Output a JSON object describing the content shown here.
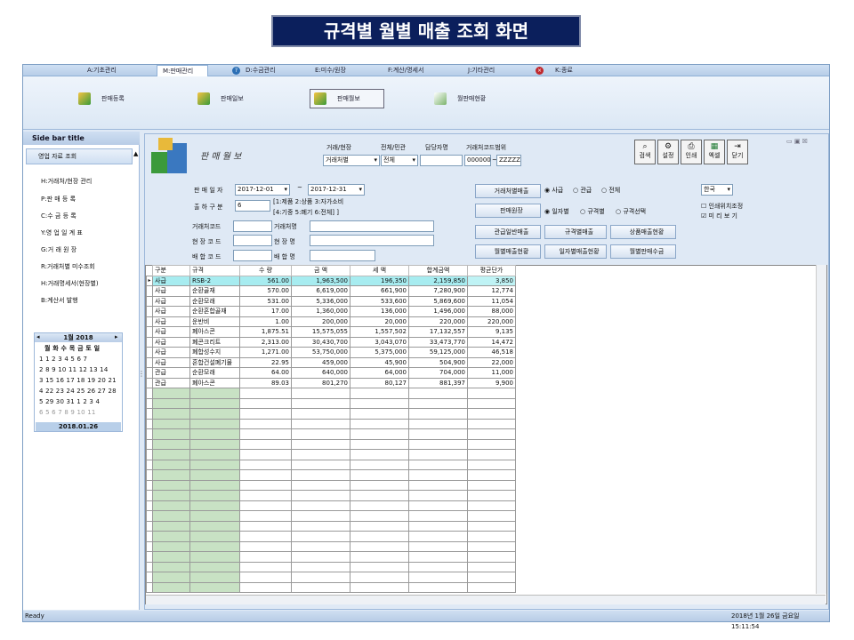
{
  "banner": "규격별 월별 매출 조회 화면",
  "menu": {
    "items": [
      {
        "label": "A:기초관리",
        "active": false
      },
      {
        "label": "M:판매관리",
        "active": true
      },
      {
        "label": "D:수금관리",
        "active": false
      },
      {
        "label": "E:미수/원장",
        "active": false
      },
      {
        "label": "F:계산/명세서",
        "active": false
      },
      {
        "label": "J:기타관리",
        "active": false
      },
      {
        "label": "K:종료",
        "active": false
      }
    ]
  },
  "ribbon": {
    "items": [
      "판매등록",
      "판매일보",
      "판매월보",
      "월판매현황"
    ]
  },
  "sidebar": {
    "title": "Side bar title",
    "section": "영업 자료 조회",
    "items": [
      "H:거래처/현장 관리",
      "P:판 매 등 록",
      "C:수 금 등 록",
      "Y:영 업 일 계 표",
      "G:거 래 원 장",
      "R:거래처별 미수조회",
      "H:거래명세서(현장별)",
      "B:계산서 발행"
    ]
  },
  "calendar": {
    "title": "1월 2018",
    "weekdays": "월 화 수 목 금 토 일",
    "rows": [
      "1  1  2  3  4  5  6  7",
      "2  8  9 10 11 12 13 14",
      "3 15 16 17 18 19 20 21",
      "4 22 23 24 25 26 27 28",
      "5 29 30 31  1  2  3  4",
      "6  5  6  7  8  9 10 11"
    ],
    "today": "2018.01.26"
  },
  "form": {
    "title": "판 매 월 보",
    "trade_site_label": "거래/현장",
    "trade_site_value": "거래처별",
    "all_label": "전체/민관",
    "all_value": "전체",
    "staff_label": "담당자명",
    "range_label": "거래처코드범위",
    "range_from": "000000",
    "range_sep": "~",
    "range_to": "ZZZZZ",
    "date_label": "판 매 일 자",
    "date_from": "2017-12-01",
    "date_tilde": "~",
    "date_to": "2017-12-31",
    "ship_label": "출 하 구 분",
    "ship_value": "6",
    "ship_note1": "[1:제품 2:상품 3:자가소비",
    "ship_note2": "[4:기중 5:폐기 6:전체] ]",
    "code_label": "거래처코드",
    "name_label": "거래처명",
    "site_code_label": "현 장 코 드",
    "site_name_label": "현 장 명",
    "mix_code_label": "배 합 코 드",
    "mix_name_label": "배 합 명"
  },
  "toolbar": {
    "search": "검색",
    "setting": "설정",
    "print": "인쇄",
    "excel": "엑셀",
    "close": "닫기"
  },
  "reports": {
    "r1": "거래처별매출",
    "r2": "판매원장",
    "r3": "관급일반매출",
    "r4": "규격별매출",
    "r5": "상품매출현황",
    "r6": "월별매출현황",
    "r7": "일자별매출현황",
    "r8": "월별판매수금"
  },
  "radios1": {
    "a": "사급",
    "b": "관급",
    "c": "전체"
  },
  "radios2": {
    "a": "일자별",
    "b": "규격별",
    "c": "규격선택"
  },
  "lang": "한국",
  "checks": {
    "a": "인쇄위치조정",
    "b": "미 리 보 기"
  },
  "table": {
    "headers": [
      "구분",
      "규격",
      "수 량",
      "금 액",
      "세 액",
      "합계금액",
      "평균단가"
    ],
    "rows": [
      [
        "사급",
        "RSB-2",
        "561.00",
        "1,963,500",
        "196,350",
        "2,159,850",
        "3,850"
      ],
      [
        "사급",
        "순환골재",
        "570.00",
        "6,619,000",
        "661,900",
        "7,280,900",
        "12,774"
      ],
      [
        "사급",
        "순환모래",
        "531.00",
        "5,336,000",
        "533,600",
        "5,869,600",
        "11,054"
      ],
      [
        "사급",
        "순환혼합골재",
        "17.00",
        "1,360,000",
        "136,000",
        "1,496,000",
        "88,000"
      ],
      [
        "사급",
        "운반비",
        "1.00",
        "200,000",
        "20,000",
        "220,000",
        "220,000"
      ],
      [
        "사급",
        "폐아스콘",
        "1,875.51",
        "15,575,055",
        "1,557,502",
        "17,132,557",
        "9,135"
      ],
      [
        "사급",
        "폐콘크리트",
        "2,313.00",
        "30,430,700",
        "3,043,070",
        "33,473,770",
        "14,472"
      ],
      [
        "사급",
        "폐합성수지",
        "1,271.00",
        "53,750,000",
        "5,375,000",
        "59,125,000",
        "46,518"
      ],
      [
        "사급",
        "혼합건설폐기물",
        "22.95",
        "459,000",
        "45,900",
        "504,900",
        "22,000"
      ],
      [
        "관급",
        "순환모래",
        "64.00",
        "640,000",
        "64,000",
        "704,000",
        "11,000"
      ],
      [
        "관급",
        "폐아스콘",
        "89.03",
        "801,270",
        "80,127",
        "881,397",
        "9,900"
      ]
    ]
  },
  "status": {
    "left": "Ready",
    "right": "2018년 1월 26일 금요일 15:11:54"
  }
}
